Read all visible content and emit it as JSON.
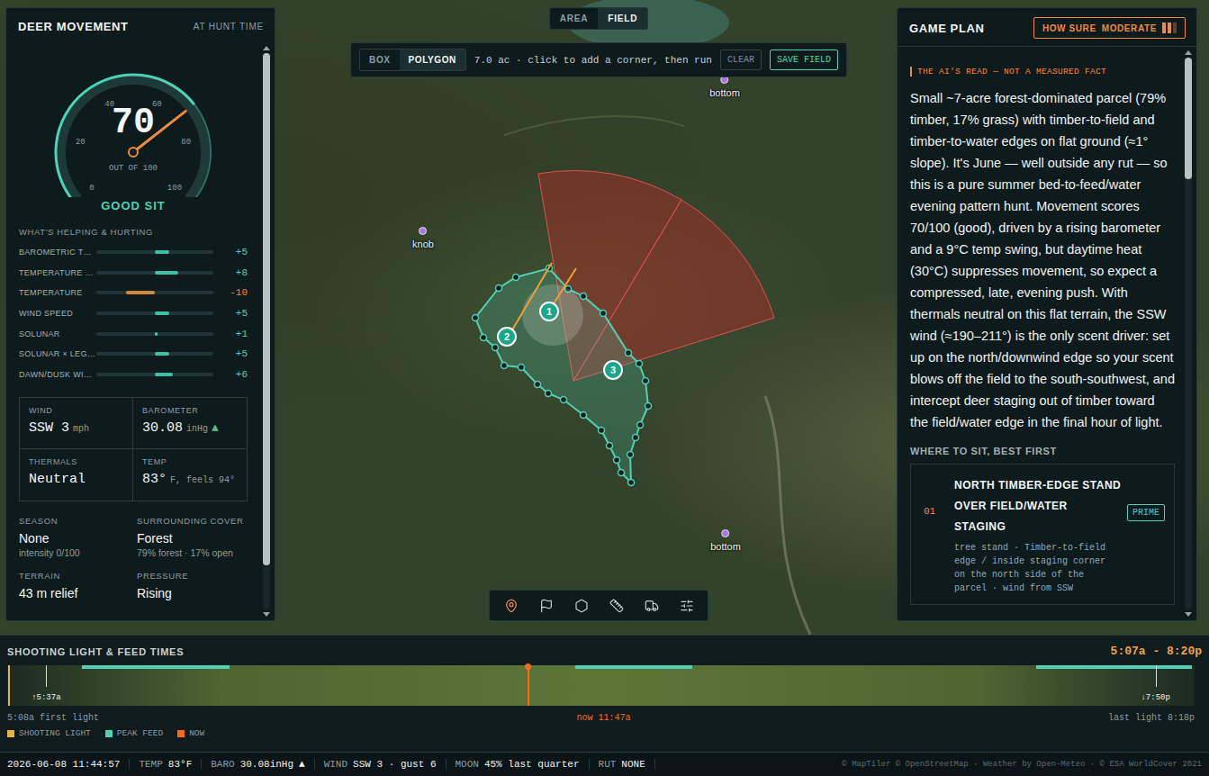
{
  "left_panel": {
    "title": "DEER MOVEMENT",
    "subtitle": "AT HUNT TIME",
    "gauge": {
      "value": "70",
      "caption": "OUT OF 100",
      "level": 0.7,
      "ticks": [
        "0",
        "20",
        "40",
        "60",
        "80",
        "100"
      ]
    },
    "verdict": "GOOD SIT",
    "factors_title": "WHAT'S HELPING & HURTING",
    "factors": [
      {
        "label": "BAROMETRIC T…",
        "value": "+5",
        "level": 0.25,
        "color": "#3fbfa4"
      },
      {
        "label": "TEMPERATURE …",
        "value": "+8",
        "level": 0.4,
        "color": "#3fbfa4"
      },
      {
        "label": "TEMPERATURE",
        "value": "-10",
        "level": 0.5,
        "color": "#d08a3a"
      },
      {
        "label": "WIND SPEED",
        "value": "+5",
        "level": 0.25,
        "color": "#3fbfa4"
      },
      {
        "label": "SOLUNAR",
        "value": "+1",
        "level": 0.05,
        "color": "#3fbfa4"
      },
      {
        "label": "SOLUNAR × LEG…",
        "value": "+5",
        "level": 0.25,
        "color": "#3fbfa4"
      },
      {
        "label": "DAWN/DUSK WI…",
        "value": "+6",
        "level": 0.3,
        "color": "#3fbfa4"
      }
    ],
    "conditions": [
      {
        "label": "WIND",
        "value": "SSW 3",
        "unit": "mph"
      },
      {
        "label": "BAROMETER",
        "value": "30.08",
        "unit": "inHg",
        "trend": "▲"
      },
      {
        "label": "THERMALS",
        "value": "Neutral"
      },
      {
        "label": "TEMP",
        "value": "83°",
        "unit": "F, feels 94°"
      }
    ],
    "details": [
      {
        "label": "SEASON",
        "value": "None",
        "note": "intensity 0/100"
      },
      {
        "label": "SURROUNDING COVER",
        "value": "Forest",
        "note": "79% forest · 17% open"
      },
      {
        "label": "TERRAIN",
        "value": "43 m relief"
      },
      {
        "label": "PRESSURE",
        "value": "Rising"
      }
    ]
  },
  "view_tabs": [
    {
      "label": "AREA",
      "selected": false
    },
    {
      "label": "FIELD",
      "selected": true
    }
  ],
  "draw_toolbar": {
    "modes": [
      {
        "label": "BOX",
        "selected": false
      },
      {
        "label": "POLYGON",
        "selected": true
      }
    ],
    "hint": "7.0 ac · click to add a corner, then run",
    "clear": "CLEAR",
    "save": "SAVE FIELD"
  },
  "map": {
    "places": [
      {
        "label": "bottom"
      },
      {
        "label": "knob"
      },
      {
        "label": "bottom"
      }
    ],
    "stands": [
      {
        "label": "1"
      },
      {
        "label": "2"
      },
      {
        "label": "3"
      }
    ]
  },
  "map_tools": [
    {
      "selected": true
    },
    {
      "selected": false
    },
    {
      "selected": false
    },
    {
      "selected": false
    },
    {
      "selected": false
    },
    {
      "selected": false
    }
  ],
  "game_plan": {
    "title": "GAME PLAN",
    "confidence_label": "HOW SURE",
    "confidence_value": "MODERATE",
    "confidence_level": 0.67,
    "read_label": "THE AI'S READ — NOT A MEASURED FACT",
    "read": "Small ~7-acre forest-dominated parcel (79% timber, 17% grass) with timber-to-field and timber-to-water edges on flat ground (≈1° slope). It's June — well outside any rut — so this is a pure summer bed-to-feed/water evening pattern hunt. Movement scores 70/100 (good), driven by a rising barometer and a 9°C temp swing, but daytime heat (30°C) suppresses movement, so expect a compressed, late, evening push. With thermals neutral on this flat terrain, the SSW wind (≈190–211°) is the only scent driver: set up on the north/downwind edge so your scent blows off the field to the south-southwest, and intercept deer staging out of timber toward the field/water edge in the final hour of light.",
    "spots_title": "WHERE TO SIT, BEST FIRST",
    "spots": [
      {
        "rank": "01",
        "title": "NORTH TIMBER-EDGE STAND OVER FIELD/WATER STAGING",
        "badge": "PRIME",
        "detail": "tree stand · Timber-to-field edge / inside staging corner on the north side of the parcel · wind from SSW"
      }
    ]
  },
  "timeline": {
    "title": "SHOOTING LIGHT & FEED TIMES",
    "range": "5:07a - 8:20p",
    "axis_hours": [
      5.117,
      20.333
    ],
    "shooting_light_start_hours": 5.133,
    "feed_windows": [
      [
        6.08,
        7.97
      ],
      [
        12.4,
        13.9
      ],
      [
        18.3,
        20.3
      ]
    ],
    "now_hours": 11.783,
    "sunrise": {
      "label": "↑5:37a",
      "hours": 5.617
    },
    "sunset": {
      "label": "↓7:50p",
      "hours": 19.833
    },
    "first_light": "5:08a first light",
    "now_label": "now 11:47a",
    "last_light": "last light 8:18p",
    "legend": [
      {
        "label": "SHOOTING LIGHT",
        "color": "#e8b53a"
      },
      {
        "label": "PEAK FEED",
        "color": "#4fd1b5"
      },
      {
        "label": "NOW",
        "color": "#ff6a1a"
      }
    ]
  },
  "status_bar": {
    "datetime": "2026-06-08 11:44:57",
    "items": [
      {
        "label": "TEMP",
        "value": "83°F"
      },
      {
        "label": "BARO",
        "value": "30.08inHg",
        "trend": "▲"
      },
      {
        "label": "WIND",
        "value": "SSW 3 · gust 6"
      },
      {
        "label": "MOON",
        "value": "45% last quarter"
      },
      {
        "label": "RUT",
        "value": "NONE"
      }
    ],
    "credits": "© MapTiler © OpenStreetMap · Weather by Open-Meteo · © ESA WorldCover 2021"
  }
}
